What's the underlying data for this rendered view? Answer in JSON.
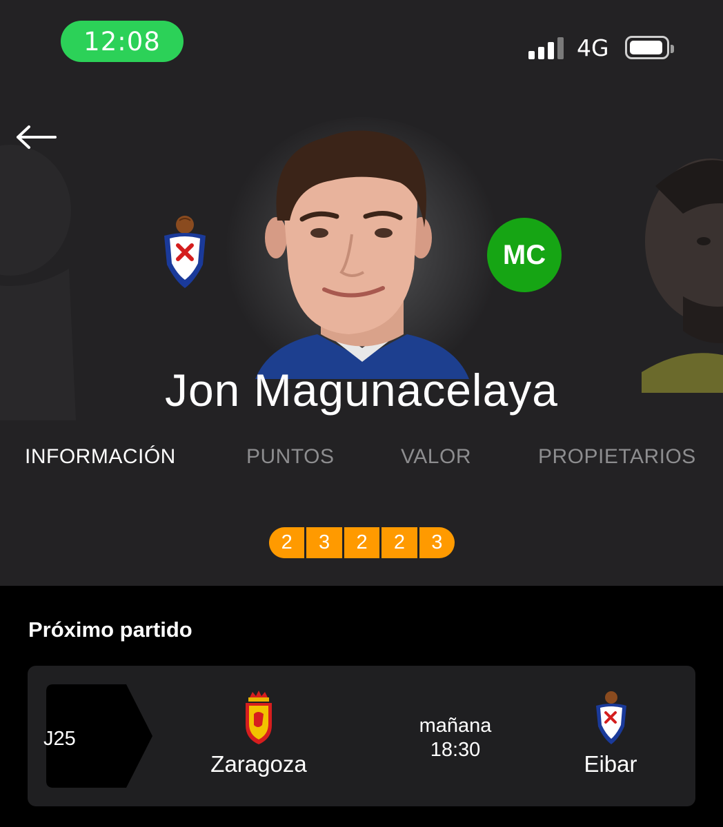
{
  "status_bar": {
    "time": "12:08",
    "network": "4G"
  },
  "player": {
    "name": "Jon Magunacelaya",
    "position": "MC"
  },
  "tabs": [
    {
      "label": "INFORMACIÓN",
      "active": true
    },
    {
      "label": "PUNTOS",
      "active": false
    },
    {
      "label": "VALOR",
      "active": false
    },
    {
      "label": "PROPIETARIOS",
      "active": false
    }
  ],
  "recent_form": [
    "2",
    "3",
    "2",
    "2",
    "3"
  ],
  "next_match": {
    "title": "Próximo partido",
    "round": "J25",
    "home_team": "Zaragoza",
    "away_team": "Eibar",
    "day": "mañana",
    "time": "18:30"
  },
  "colors": {
    "time_pill": "#2cd158",
    "position_badge": "#16a514",
    "form_cell": "#ff9a00",
    "hero_bg": "#232224",
    "card_bg": "#1f1f21"
  }
}
